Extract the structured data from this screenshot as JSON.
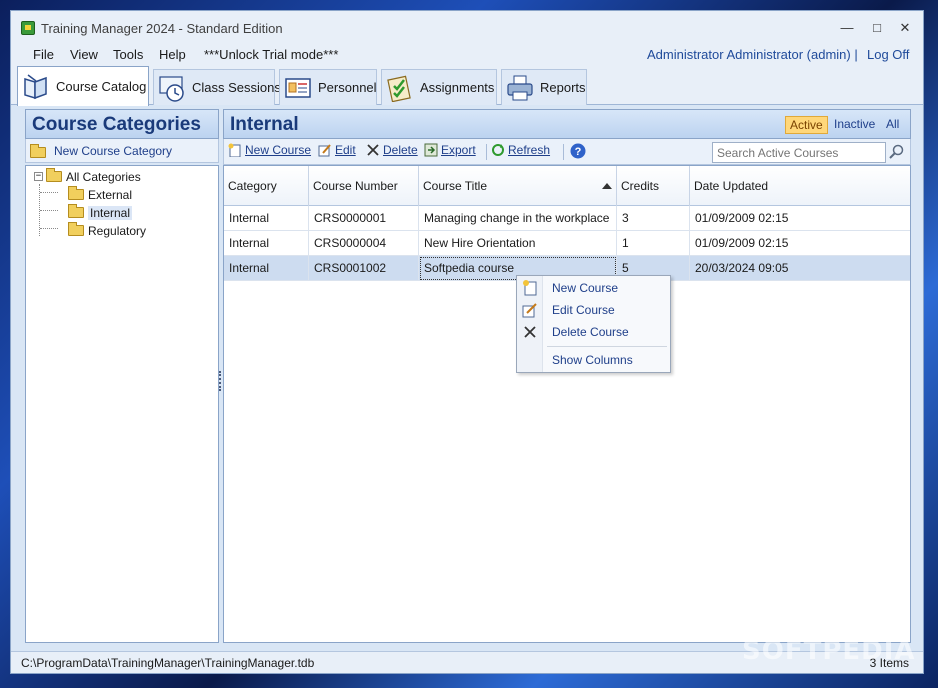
{
  "window": {
    "title": "Training Manager 2024 - Standard Edition",
    "minimize": "—",
    "maximize": "□",
    "close": "✕"
  },
  "menu": {
    "items": [
      {
        "label": "File"
      },
      {
        "label": "View"
      },
      {
        "label": "Tools"
      },
      {
        "label": "Help"
      }
    ],
    "unlock": "***Unlock Trial mode***",
    "user": "Administrator Administrator (admin)  |",
    "logoff": "Log Off"
  },
  "tabs": [
    {
      "label": "Course Catalog",
      "icon": "book-icon",
      "active": true
    },
    {
      "label": "Class Sessions",
      "icon": "clock-icon",
      "active": false
    },
    {
      "label": "Personnel",
      "icon": "id-card-icon",
      "active": false
    },
    {
      "label": "Assignments",
      "icon": "checklist-icon",
      "active": false
    },
    {
      "label": "Reports",
      "icon": "printer-icon",
      "active": false
    }
  ],
  "categories": {
    "title": "Course Categories",
    "new_button": "New Course Category",
    "tree": [
      {
        "label": "All Categories",
        "level": 0,
        "expanded": true
      },
      {
        "label": "External",
        "level": 1
      },
      {
        "label": "Internal",
        "level": 1,
        "selected": true
      },
      {
        "label": "Regulatory",
        "level": 1
      }
    ]
  },
  "courses": {
    "title": "Internal",
    "filters": [
      {
        "label": "Active",
        "active": true
      },
      {
        "label": "Inactive",
        "active": false
      },
      {
        "label": "All",
        "active": false
      }
    ],
    "toolbar": {
      "new": "New Course",
      "edit": "Edit",
      "delete": "Delete",
      "export": "Export",
      "refresh": "Refresh"
    },
    "search_placeholder": "Search Active Courses",
    "columns": [
      "Category",
      "Course Number",
      "Course Title",
      "Credits",
      "Date Updated"
    ],
    "sort_column": "Course Title",
    "rows": [
      [
        "Internal",
        "CRS0000001",
        "Managing change in the workplace",
        "3",
        "01/09/2009 02:15"
      ],
      [
        "Internal",
        "CRS0000004",
        "New Hire Orientation",
        "1",
        "01/09/2009 02:15"
      ],
      [
        "Internal",
        "CRS0001002",
        "Softpedia course",
        "5",
        "20/03/2024 09:05"
      ]
    ],
    "selected_row": 2
  },
  "context_menu": {
    "items": [
      {
        "label": "New Course",
        "icon": "new-document-icon"
      },
      {
        "label": "Edit Course",
        "icon": "edit-icon"
      },
      {
        "label": "Delete Course",
        "icon": "delete-x-icon"
      },
      {
        "label": "Show Columns",
        "icon": ""
      }
    ]
  },
  "status": {
    "path": "C:\\ProgramData\\TrainingManager\\TrainingManager.tdb",
    "count": "3 Items"
  },
  "watermark": "SOFTPEDIA",
  "colors": {
    "accent": "#1a3a7a",
    "link": "#1f3f8a",
    "active_filter": "#ffd77a",
    "selected_row": "#cddcf0"
  }
}
